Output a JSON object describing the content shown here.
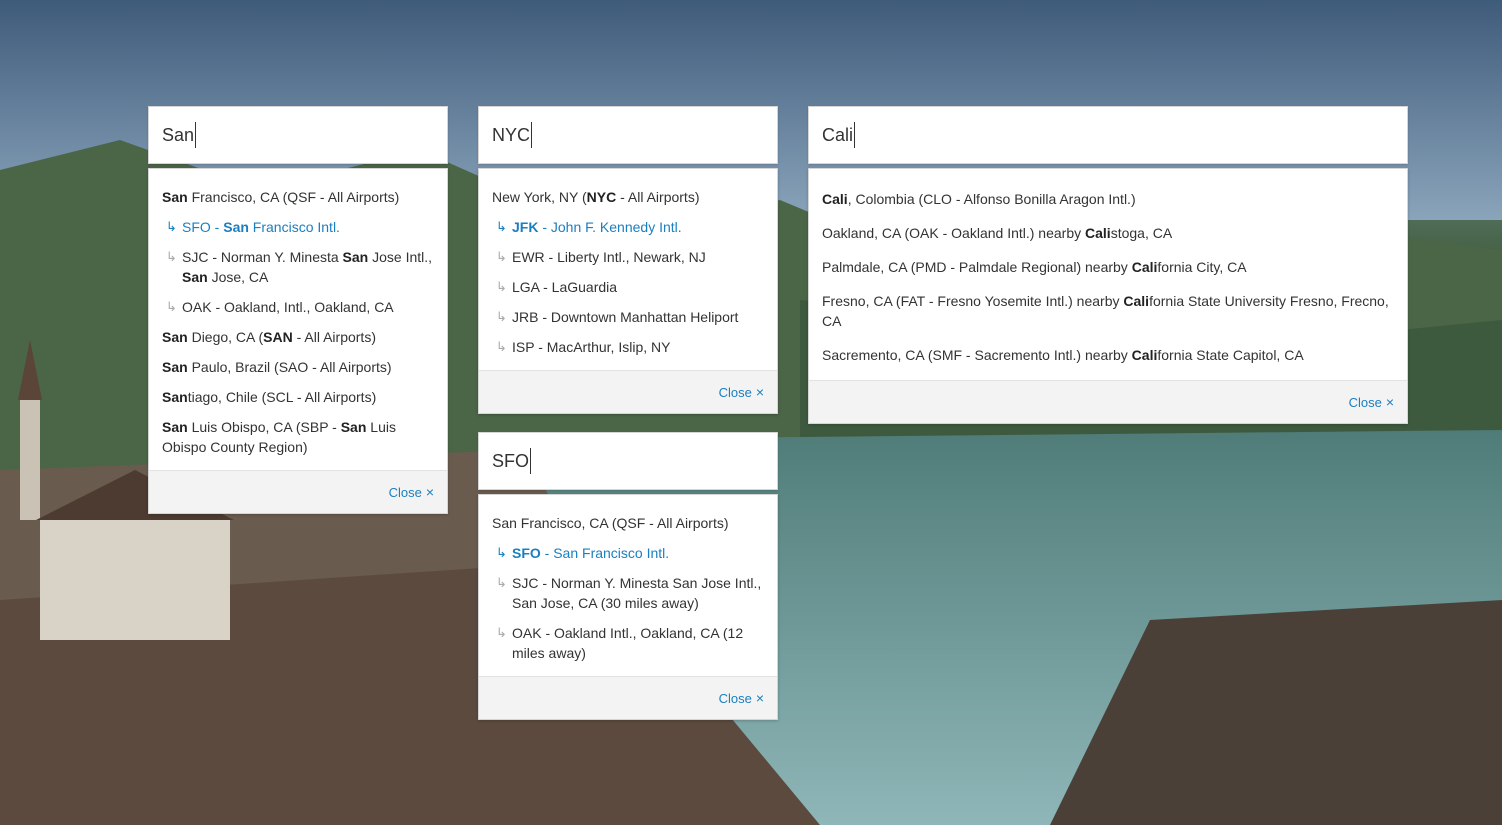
{
  "background": {
    "description_icon": "mountain-lake-town-photo"
  },
  "widgets": [
    {
      "query": "San",
      "close_label": "Close",
      "close_icon": "×",
      "results": [
        {
          "type": "city",
          "parts": [
            [
              "San",
              true
            ],
            [
              " Francisco, CA (QSF - All Airports)",
              false
            ]
          ]
        },
        {
          "type": "airport",
          "active": true,
          "parts": [
            [
              "SFO - ",
              false
            ],
            [
              "San",
              true
            ],
            [
              " Francisco Intl.",
              false
            ]
          ]
        },
        {
          "type": "airport",
          "parts": [
            [
              "SJC - Norman Y. Minesta ",
              false
            ],
            [
              "San",
              true
            ],
            [
              " Jose Intl., ",
              false
            ],
            [
              "San",
              true
            ],
            [
              " Jose, CA",
              false
            ]
          ]
        },
        {
          "type": "airport",
          "parts": [
            [
              "OAK - Oakland, Intl., Oakland, CA",
              false
            ]
          ]
        },
        {
          "type": "city",
          "parts": [
            [
              "San",
              true
            ],
            [
              " Diego, CA (",
              false
            ],
            [
              "SAN",
              true
            ],
            [
              " - All Airports)",
              false
            ]
          ]
        },
        {
          "type": "city",
          "parts": [
            [
              "San",
              true
            ],
            [
              " Paulo, Brazil (SAO - All Airports)",
              false
            ]
          ]
        },
        {
          "type": "city",
          "parts": [
            [
              "San",
              true
            ],
            [
              "tiago, Chile (SCL - All Airports)",
              false
            ]
          ]
        },
        {
          "type": "city",
          "parts": [
            [
              "San",
              true
            ],
            [
              " Luis Obispo, CA (SBP - ",
              false
            ],
            [
              "San",
              true
            ],
            [
              " Luis Obispo County Region)",
              false
            ]
          ]
        }
      ]
    },
    {
      "query": "NYC",
      "close_label": "Close",
      "close_icon": "×",
      "results": [
        {
          "type": "city",
          "parts": [
            [
              "New York, NY (",
              false
            ],
            [
              "NYC",
              true
            ],
            [
              " - All Airports)",
              false
            ]
          ]
        },
        {
          "type": "airport",
          "active": true,
          "parts": [
            [
              "JFK",
              true
            ],
            [
              " - John F. Kennedy Intl.",
              false
            ]
          ]
        },
        {
          "type": "airport",
          "parts": [
            [
              "EWR - Liberty Intl., Newark, NJ",
              false
            ]
          ]
        },
        {
          "type": "airport",
          "parts": [
            [
              "LGA - LaGuardia",
              false
            ]
          ]
        },
        {
          "type": "airport",
          "parts": [
            [
              "JRB - Downtown Manhattan Heliport",
              false
            ]
          ]
        },
        {
          "type": "airport",
          "parts": [
            [
              "ISP - MacArthur, Islip, NY",
              false
            ]
          ]
        }
      ]
    },
    {
      "query": "SFO",
      "close_label": "Close",
      "close_icon": "×",
      "results": [
        {
          "type": "city",
          "parts": [
            [
              "San Francisco, CA (QSF - All Airports)",
              false
            ]
          ]
        },
        {
          "type": "airport",
          "active": true,
          "parts": [
            [
              "SFO",
              true
            ],
            [
              " - San Francisco Intl.",
              false
            ]
          ]
        },
        {
          "type": "airport",
          "parts": [
            [
              "SJC - Norman Y. Minesta San Jose Intl., San Jose, CA (30 miles away)",
              false
            ]
          ]
        },
        {
          "type": "airport",
          "parts": [
            [
              "OAK - Oakland Intl., Oakland, CA (12 miles away)",
              false
            ]
          ]
        }
      ]
    },
    {
      "query": "Cali",
      "close_label": "Close",
      "close_icon": "×",
      "results": [
        {
          "type": "city",
          "parts": [
            [
              "Cali",
              true
            ],
            [
              ", Colombia (CLO - Alfonso Bonilla Aragon Intl.)",
              false
            ]
          ]
        },
        {
          "type": "city",
          "parts": [
            [
              "Oakland, CA (OAK - Oakland Intl.) nearby ",
              false
            ],
            [
              "Cali",
              true
            ],
            [
              "stoga, CA",
              false
            ]
          ]
        },
        {
          "type": "city",
          "parts": [
            [
              "Palmdale, CA (PMD - Palmdale Regional) nearby ",
              false
            ],
            [
              "Cali",
              true
            ],
            [
              "fornia City, CA",
              false
            ]
          ]
        },
        {
          "type": "city",
          "parts": [
            [
              "Fresno, CA (FAT - Fresno Yosemite Intl.) nearby ",
              false
            ],
            [
              "Cali",
              true
            ],
            [
              "fornia State University Fresno, Frecno, CA",
              false
            ]
          ]
        },
        {
          "type": "city",
          "parts": [
            [
              "Sacremento, CA (SMF - Sacremento Intl.) nearby ",
              false
            ],
            [
              "Cali",
              true
            ],
            [
              "fornia State Capitol, CA",
              false
            ]
          ]
        }
      ]
    }
  ],
  "colors": {
    "link": "#1a7fc1",
    "text": "#333333",
    "footer_bg": "#f3f3f3"
  }
}
